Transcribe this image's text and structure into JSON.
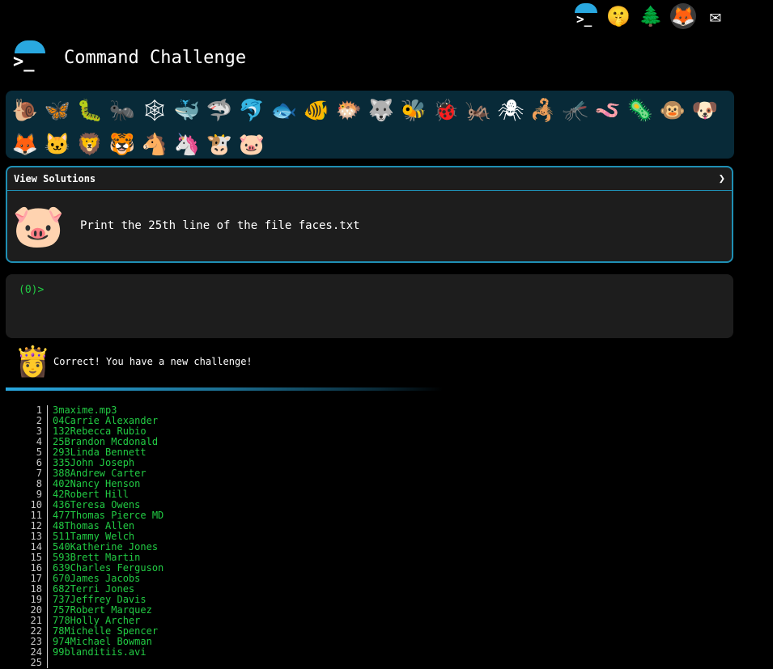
{
  "topbar": [
    {
      "name": "terminal-logo-icon",
      "glyph": ""
    },
    {
      "name": "shushing-face-icon",
      "glyph": "🤫"
    },
    {
      "name": "tree-icon",
      "glyph": "🌲"
    },
    {
      "name": "gitlab-icon",
      "glyph": "🦊"
    },
    {
      "name": "envelope-icon",
      "glyph": "✉"
    }
  ],
  "header": {
    "logo_prompt": ">_",
    "title": "Command Challenge"
  },
  "animals": [
    "🐌",
    "🦋",
    "🐛",
    "🐜",
    "🕸",
    "🐳",
    "🦈",
    "🐬",
    "🐟",
    "🐠",
    "🐡",
    "🐺",
    "🐝",
    "🐞",
    "🦗",
    "🕷",
    "🦂",
    "🦟",
    "🪱",
    "🦠",
    "🐵",
    "🐶",
    "🦊",
    "🐱",
    "🦁",
    "🐯",
    "🐴",
    "🦄",
    "🐮",
    "🐷"
  ],
  "solutions": {
    "label": "View Solutions",
    "chevron": "❯",
    "pig": "🐷",
    "challenge": "Print the 25th line of the file faces.txt"
  },
  "terminal": {
    "prompt": "(0)>"
  },
  "message": {
    "avatar": "👸",
    "text": "Correct! You have a new challenge!"
  },
  "output_lines": [
    {
      "n": "1",
      "t": "3maxime.mp3"
    },
    {
      "n": "2",
      "t": "04Carrie Alexander"
    },
    {
      "n": "3",
      "t": "132Rebecca Rubio"
    },
    {
      "n": "4",
      "t": "25Brandon Mcdonald"
    },
    {
      "n": "5",
      "t": "293Linda Bennett"
    },
    {
      "n": "6",
      "t": "335John Joseph"
    },
    {
      "n": "7",
      "t": "388Andrew Carter"
    },
    {
      "n": "8",
      "t": "402Nancy Henson"
    },
    {
      "n": "9",
      "t": "42Robert Hill"
    },
    {
      "n": "10",
      "t": "436Teresa Owens"
    },
    {
      "n": "11",
      "t": "477Thomas Pierce MD"
    },
    {
      "n": "12",
      "t": "48Thomas Allen"
    },
    {
      "n": "13",
      "t": "511Tammy Welch"
    },
    {
      "n": "14",
      "t": "540Katherine Jones"
    },
    {
      "n": "15",
      "t": "593Brett Martin"
    },
    {
      "n": "16",
      "t": "639Charles Ferguson"
    },
    {
      "n": "17",
      "t": "670James Jacobs"
    },
    {
      "n": "18",
      "t": "682Terri Jones"
    },
    {
      "n": "19",
      "t": "737Jeffrey Davis"
    },
    {
      "n": "20",
      "t": "757Robert Marquez"
    },
    {
      "n": "21",
      "t": "778Holly Archer"
    },
    {
      "n": "22",
      "t": "78Michelle Spencer"
    },
    {
      "n": "23",
      "t": "974Michael Bowman"
    },
    {
      "n": "24",
      "t": "99blanditiis.avi"
    },
    {
      "n": "25",
      "t": ""
    }
  ]
}
